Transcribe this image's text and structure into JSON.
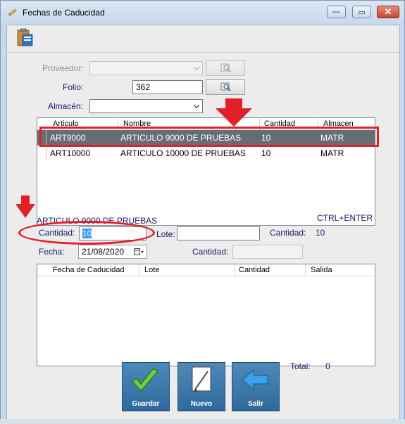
{
  "window": {
    "title": "Fechas de Caducidad",
    "caption_buttons": {
      "minimize": "—",
      "maximize": "▭",
      "close": "✕"
    }
  },
  "form": {
    "proveedor_label": "Proveedor:",
    "proveedor_value": "",
    "folio_label": "Folio:",
    "folio_value": "362",
    "almacen_label": "Almacén:",
    "almacen_value": ""
  },
  "articles_grid": {
    "columns": [
      "Articulo",
      "Nombre",
      "Cantidad",
      "Almacen"
    ],
    "rows": [
      {
        "articulo": "ART9000",
        "nombre": "ARTICULO 9000 DE PRUEBAS",
        "cantidad": "10",
        "almacen": "MATR",
        "selected": true
      },
      {
        "articulo": "ART10000",
        "nombre": "ARTICULO 10000 DE PRUEBAS",
        "cantidad": "10",
        "almacen": "MATR",
        "selected": false
      }
    ]
  },
  "detail": {
    "article_caption": "ARTICULO 9000 DE PRUEBAS",
    "shortcut": "CTRL+ENTER",
    "cantidad_label": "Cantidad:",
    "cantidad_value": "10",
    "lote_label": "Lote:",
    "lote_value": "",
    "cantidad_total_label": "Cantidad:",
    "cantidad_total_value": "10",
    "fecha_label": "Fecha:",
    "fecha_value": "21/08/2020",
    "cantidad2_label": "Cantidad:",
    "cantidad2_value": ""
  },
  "expiry_grid": {
    "columns": [
      "Fecha de Caducidad",
      "Lote",
      "Cantidad",
      "Salida"
    ]
  },
  "total": {
    "label": "Total:",
    "value": "0"
  },
  "buttons": {
    "guardar": "Guardar",
    "nuevo": "Nuevo",
    "salir": "Salir"
  },
  "colors": {
    "annotation_red": "#e3202a",
    "selected_row": "#666d73",
    "button_blue": "#3a76a8",
    "label_blue": "#1b1b6e"
  }
}
